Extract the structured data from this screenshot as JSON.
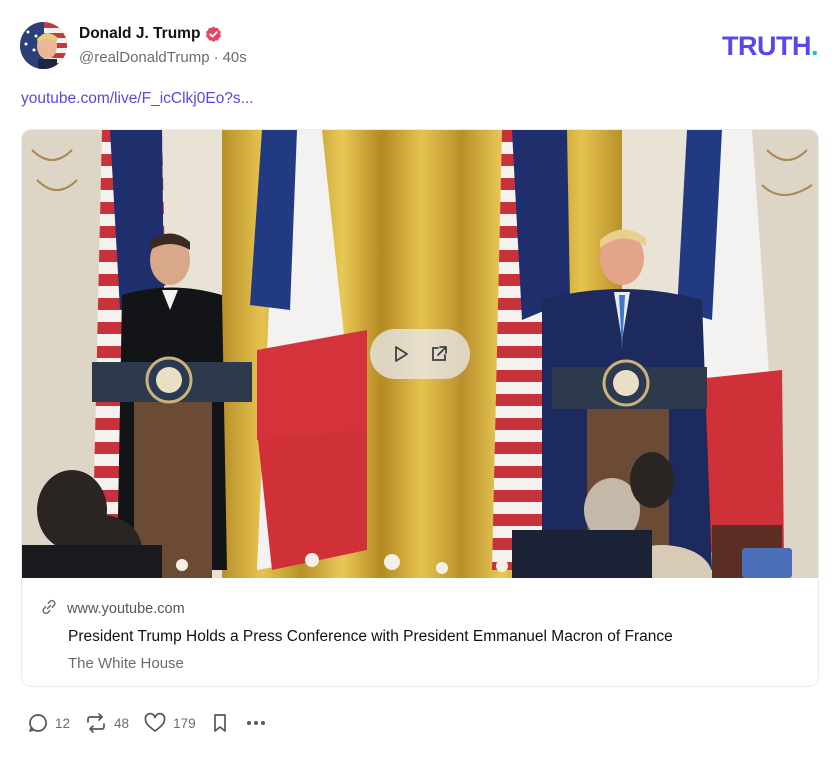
{
  "post": {
    "author_name": "Donald J. Trump",
    "handle": "@realDonaldTrump",
    "separator": "·",
    "timestamp": "40s",
    "link_text": "youtube.com/live/F_icClkj0Eo?s..."
  },
  "brand": {
    "logo_text": "TRUTH",
    "logo_dot": ".",
    "accent_color": "#5448ee",
    "dot_color": "#18c4c4"
  },
  "link_card": {
    "domain": "www.youtube.com",
    "title": "President Trump Holds a Press Conference with President Emmanuel Macron of France",
    "source": "The White House"
  },
  "actions": {
    "reply_count": "12",
    "retruth_count": "48",
    "like_count": "179"
  },
  "icons": [
    "verified-icon",
    "play-icon",
    "external-link-icon",
    "link-icon",
    "reply-icon",
    "retruth-icon",
    "like-icon",
    "bookmark-icon",
    "more-icon"
  ]
}
